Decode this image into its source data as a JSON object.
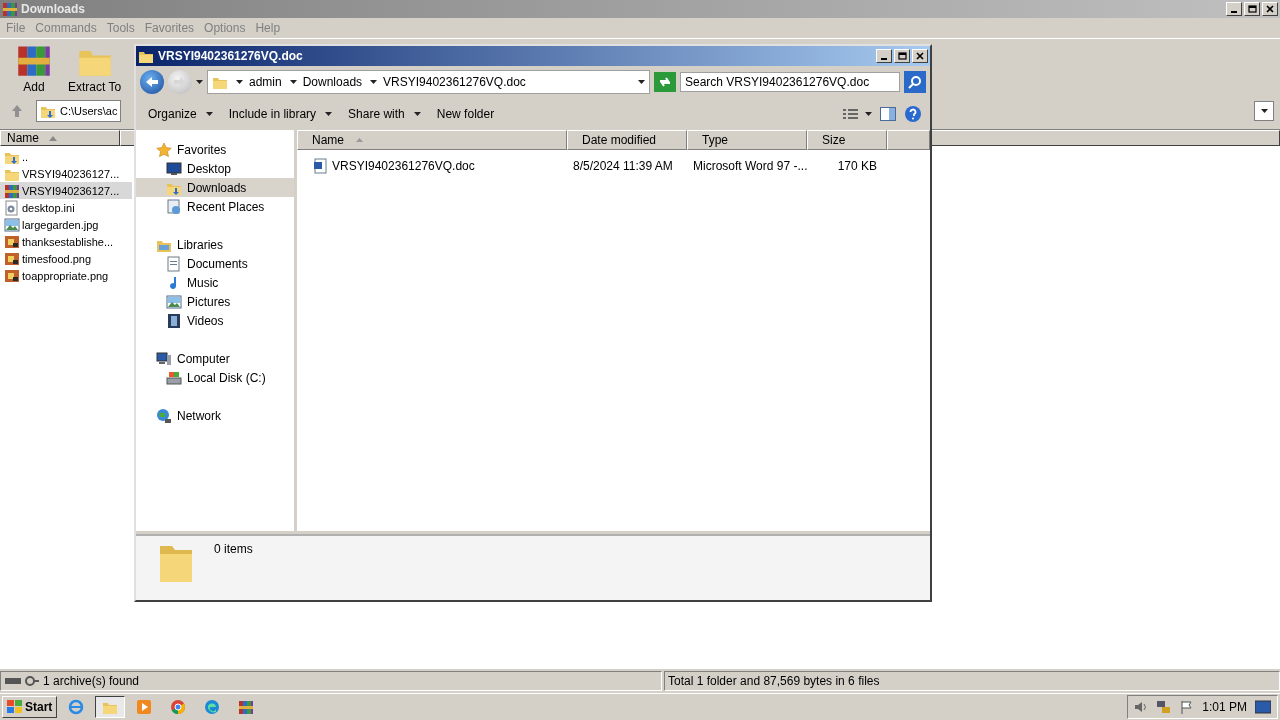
{
  "winrar": {
    "title": "Downloads",
    "menu": [
      "File",
      "Commands",
      "Tools",
      "Favorites",
      "Options",
      "Help"
    ],
    "toolbar": [
      {
        "label": "Add",
        "kind": "add"
      },
      {
        "label": "Extract To",
        "kind": "extract"
      }
    ],
    "address": "C:\\Users\\ac",
    "column": "Name",
    "files": [
      {
        "name": "..",
        "kind": "up",
        "selected": false
      },
      {
        "name": "VRSYI940236127...",
        "kind": "folder",
        "selected": false
      },
      {
        "name": "VRSYI940236127...",
        "kind": "rar",
        "selected": true
      },
      {
        "name": "desktop.ini",
        "kind": "ini",
        "selected": false
      },
      {
        "name": "largegarden.jpg",
        "kind": "jpg",
        "selected": false
      },
      {
        "name": "thanksestablishe...",
        "kind": "png",
        "selected": false
      },
      {
        "name": "timesfood.png",
        "kind": "png",
        "selected": false
      },
      {
        "name": "toappropriate.png",
        "kind": "png",
        "selected": false
      }
    ],
    "status_left": "1 archive(s) found",
    "status_right": "Total 1 folder and 87,569 bytes in 6 files"
  },
  "explorer": {
    "title": "VRSYI9402361276VQ.doc",
    "breadcrumb": [
      "admin",
      "Downloads",
      "VRSYI9402361276VQ.doc"
    ],
    "search": {
      "placeholder": "Search VRSYI9402361276VQ.doc"
    },
    "commands": [
      {
        "label": "Organize",
        "dropdown": true
      },
      {
        "label": "Include in library",
        "dropdown": true
      },
      {
        "label": "Share with",
        "dropdown": true
      },
      {
        "label": "New folder",
        "dropdown": false
      }
    ],
    "nav": [
      {
        "label": "Favorites",
        "kind": "star",
        "selected": false,
        "children": [
          {
            "label": "Desktop",
            "kind": "desktop",
            "selected": false
          },
          {
            "label": "Downloads",
            "kind": "downloads",
            "selected": true
          },
          {
            "label": "Recent Places",
            "kind": "recent",
            "selected": false
          }
        ]
      },
      {
        "label": "Libraries",
        "kind": "library",
        "selected": false,
        "children": [
          {
            "label": "Documents",
            "kind": "documents",
            "selected": false
          },
          {
            "label": "Music",
            "kind": "music",
            "selected": false
          },
          {
            "label": "Pictures",
            "kind": "pictures",
            "selected": false
          },
          {
            "label": "Videos",
            "kind": "videos",
            "selected": false
          }
        ]
      },
      {
        "label": "Computer",
        "kind": "computer",
        "selected": false,
        "children": [
          {
            "label": "Local Disk (C:)",
            "kind": "disk",
            "selected": false
          }
        ]
      },
      {
        "label": "Network",
        "kind": "network",
        "selected": false
      }
    ],
    "columns": [
      "Name",
      "Date modified",
      "Type",
      "Size"
    ],
    "rows": [
      {
        "name": "VRSYI9402361276VQ.doc",
        "date": "8/5/2024 11:39 AM",
        "type": "Microsoft Word 97 -...",
        "size": "170 KB"
      }
    ],
    "details": "0 items"
  },
  "taskbar": {
    "start": "Start",
    "apps": [
      {
        "kind": "ie",
        "selected": false
      },
      {
        "kind": "explorer",
        "selected": true
      },
      {
        "kind": "media",
        "selected": false
      },
      {
        "kind": "chrome",
        "selected": false
      },
      {
        "kind": "edge",
        "selected": false
      },
      {
        "kind": "rar",
        "selected": false
      }
    ],
    "clock": "1:01 PM"
  }
}
